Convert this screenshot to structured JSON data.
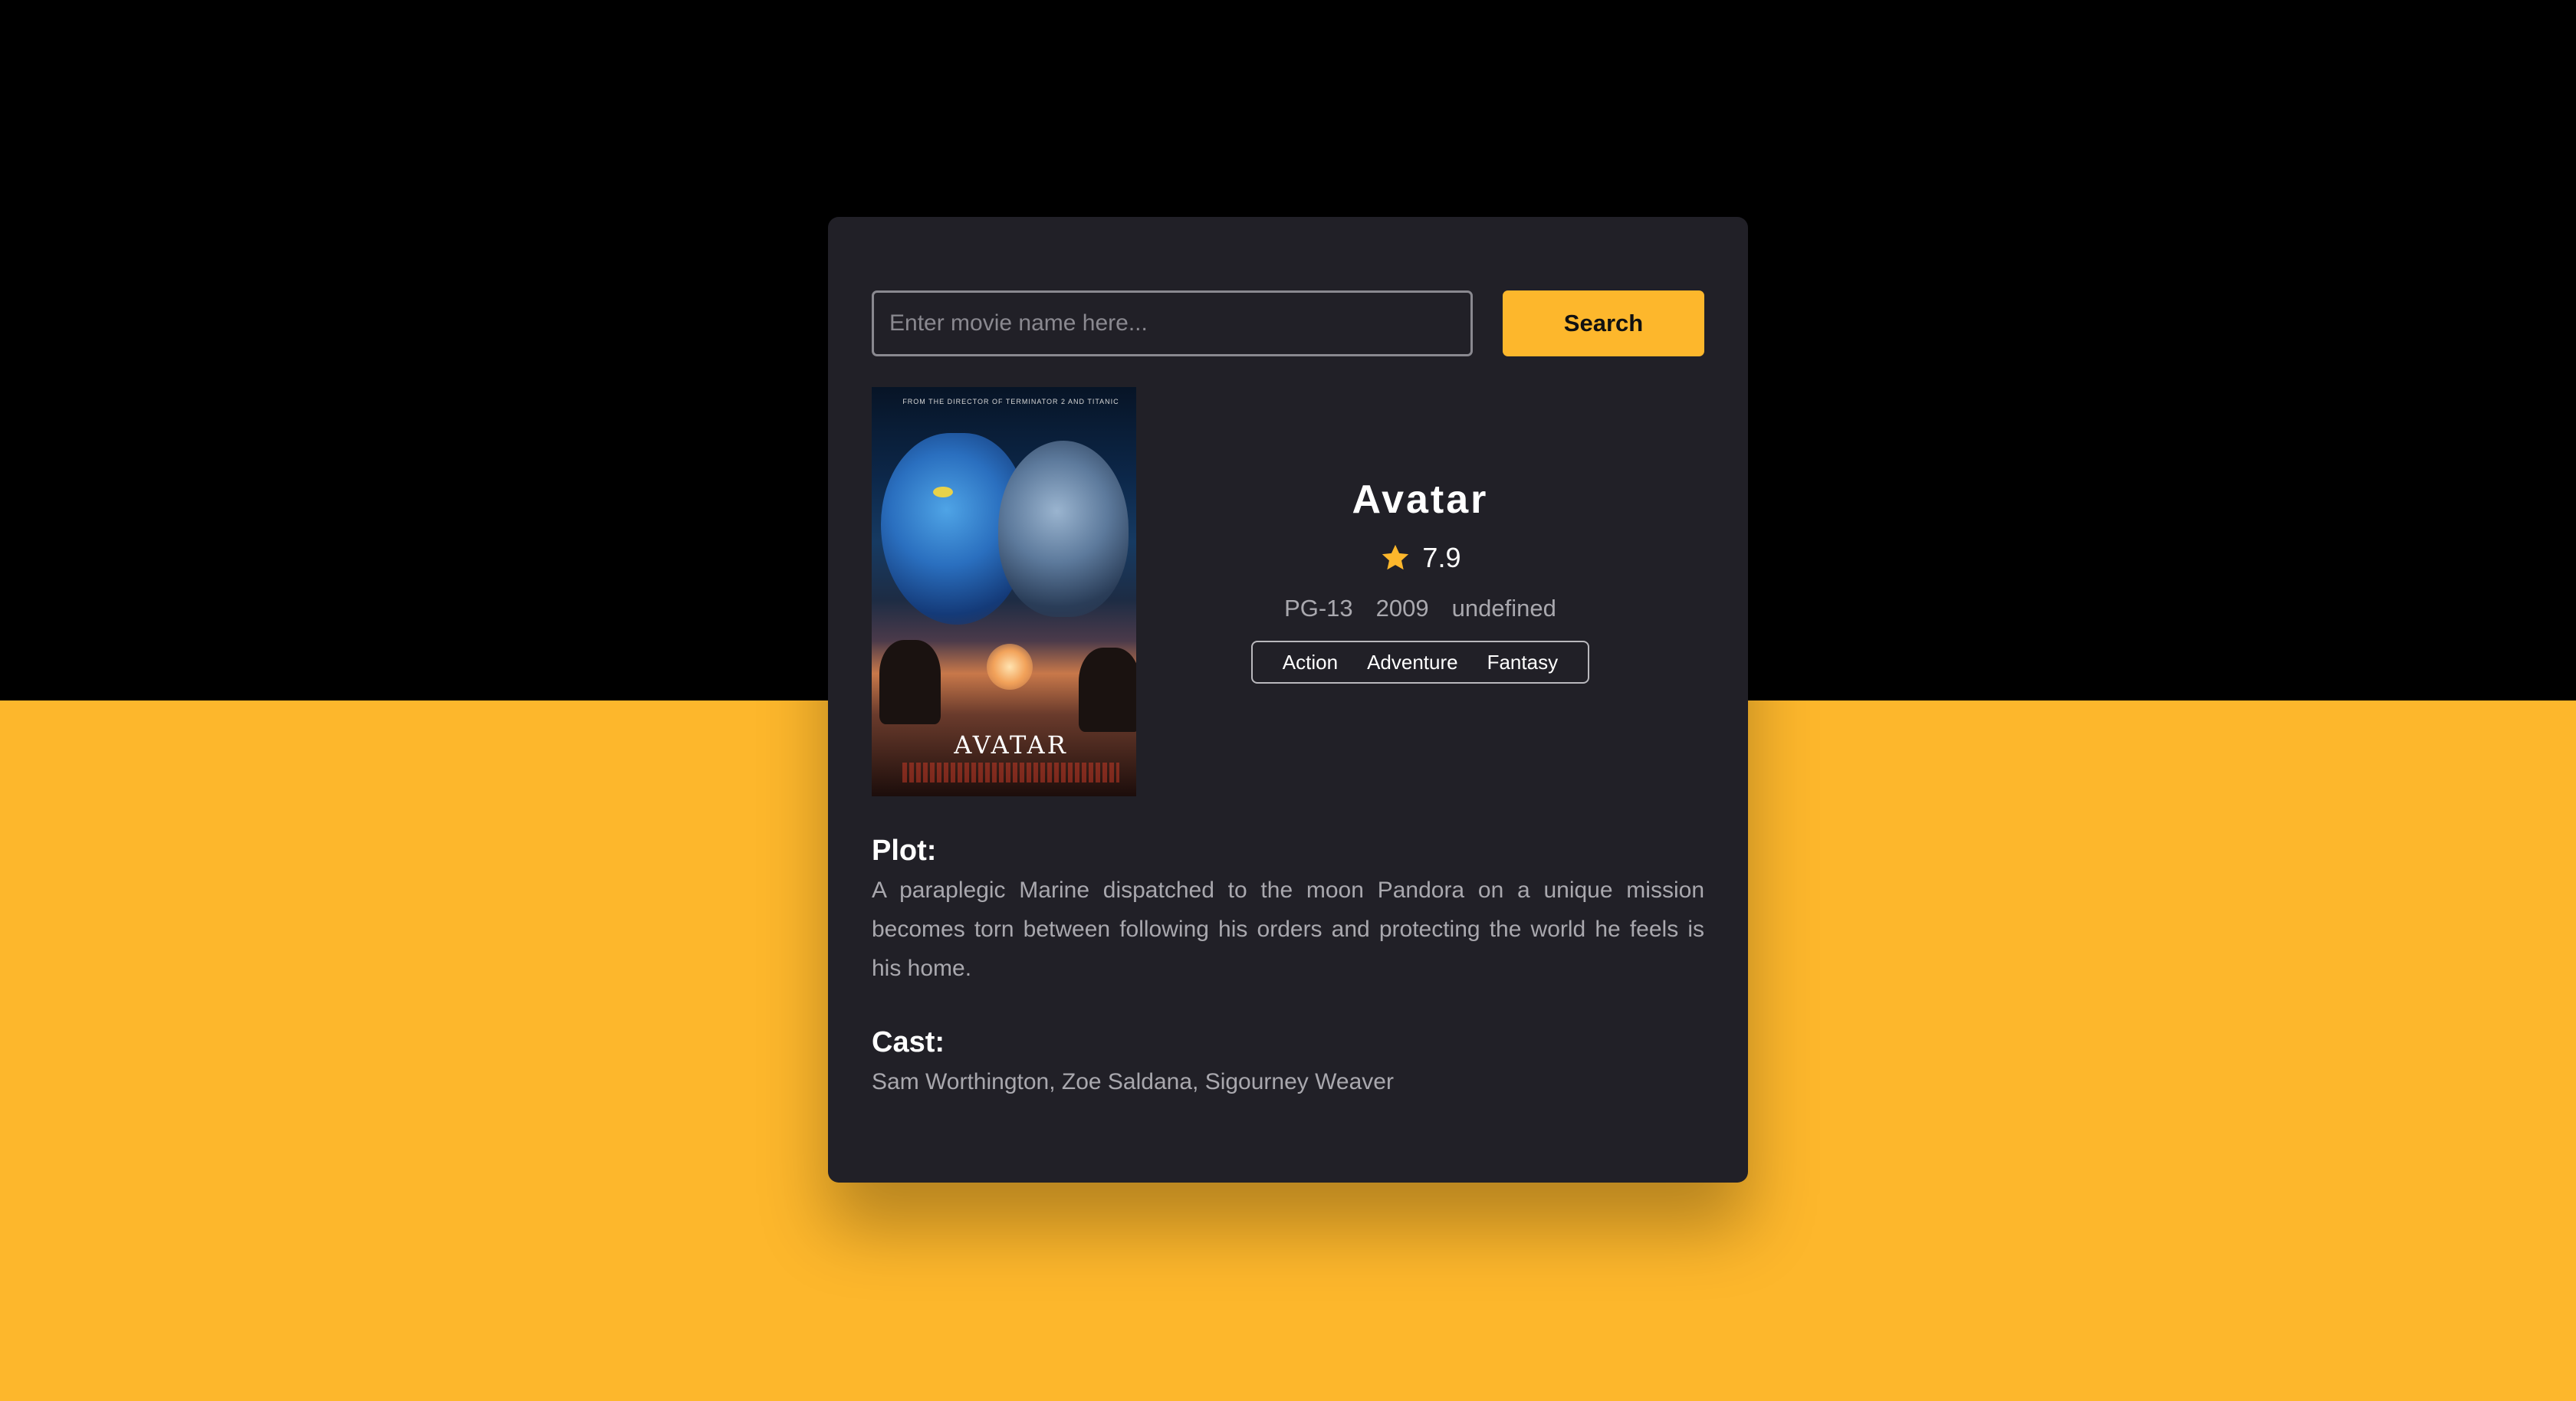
{
  "search": {
    "placeholder": "Enter movie name here...",
    "value": "",
    "button_label": "Search"
  },
  "movie": {
    "title": "Avatar",
    "poster_title": "AVATAR",
    "poster_tagline": "FROM THE DIRECTOR OF TERMINATOR 2 AND TITANIC",
    "rating": "7.9",
    "rated": "PG-13",
    "year": "2009",
    "runtime": "undefined",
    "genres": [
      "Action",
      "Adventure",
      "Fantasy"
    ]
  },
  "plot": {
    "heading": "Plot:",
    "text": "A paraplegic Marine dispatched to the moon Pandora on a unique mission becomes torn between following his orders and protecting the world he feels is his home."
  },
  "cast": {
    "heading": "Cast:",
    "text": "Sam Worthington, Zoe Saldana, Sigourney Weaver"
  },
  "colors": {
    "accent": "#fdb72c",
    "card_bg": "#212027",
    "top_bg": "#000000",
    "muted_text": "#a9a8ae"
  },
  "icons": {
    "rating": "star-icon"
  }
}
